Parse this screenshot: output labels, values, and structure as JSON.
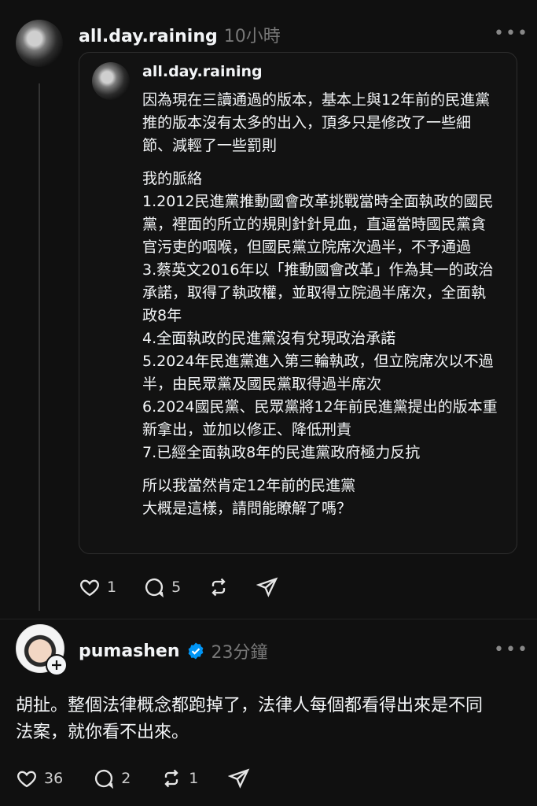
{
  "post1": {
    "username": "all.day.raining",
    "time": "10小時",
    "more": "•••",
    "quote": {
      "username": "all.day.raining",
      "paragraphs": [
        "因為現在三讀通過的版本，基本上與12年前的民進黨推的版本沒有太多的出入，頂多只是修改了一些細節、減輕了一些罰則",
        "我的脈絡\n1.2012民進黨推動國會改革挑戰當時全面執政的國民黨，裡面的所立的規則針針見血，直逼當時國民黨貪官污吏的咽喉，但國民黨立院席次過半，不予通過\n3.蔡英文2016年以「推動國會改革」作為其一的政治承諾，取得了執政權，並取得立院過半席次，全面執政8年\n4.全面執政的民進黨沒有兌現政治承諾\n5.2024年民進黨進入第三輪執政，但立院席次以不過半，由民眾黨及國民黨取得過半席次\n6.2024國民黨、民眾黨將12年前民進黨提出的版本重新拿出，並加以修正、降低刑責\n7.已經全面執政8年的民進黨政府極力反抗",
        "所以我當然肯定12年前的民進黨\n大概是這樣，請問能瞭解了嗎？"
      ]
    },
    "likes": "1",
    "replies": "5"
  },
  "post2": {
    "username": "pumashen",
    "time": "23分鐘",
    "more": "•••",
    "text": "胡扯。整個法律概念都跑掉了，法律人每個都看得出來是不同法案，就你看不出來。",
    "likes": "36",
    "replies": "2",
    "reposts": "1"
  },
  "icons": {
    "like": "heart-icon",
    "reply": "comment-icon",
    "repost": "repost-icon",
    "share": "send-icon",
    "verified": "verified-badge-icon",
    "follow": "plus-icon"
  },
  "colors": {
    "background": "#101010",
    "verified": "#0095f6",
    "secondary_text": "#777777"
  }
}
